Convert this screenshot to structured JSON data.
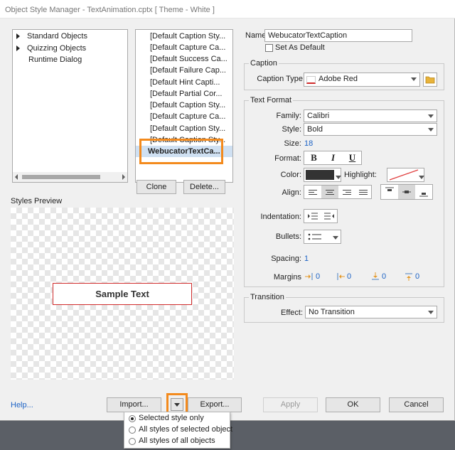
{
  "window": {
    "title": "Object Style Manager - TextAnimation.cptx [ Theme - White ]"
  },
  "tree": {
    "items": [
      {
        "label": "Standard Objects",
        "expandable": true
      },
      {
        "label": "Quizzing Objects",
        "expandable": true
      },
      {
        "label": "Runtime Dialog",
        "expandable": false
      }
    ]
  },
  "style_list": {
    "items": [
      "[Default Caption Sty...",
      "[Default Capture Ca...",
      "[Default Success Ca...",
      "[Default Failure Cap...",
      "[Default Hint Capti...",
      "[Default Partial Cor...",
      "[Default Caption Sty...",
      "[Default Capture Ca...",
      "[Default Caption Sty...",
      "[Default Caption Sty...",
      "WebucatorTextCa..."
    ],
    "selected_index": 10,
    "clone_label": "Clone",
    "delete_label": "Delete..."
  },
  "preview": {
    "title": "Styles Preview",
    "sample_text": "Sample Text"
  },
  "name_field": {
    "label": "Name",
    "value": "WebucatorTextCaption"
  },
  "set_default": {
    "label": "Set As Default",
    "checked": false
  },
  "caption": {
    "group_title": "Caption",
    "type_label": "Caption Type",
    "type_value": "Adobe Red"
  },
  "text_format": {
    "group_title": "Text Format",
    "family_label": "Family:",
    "family_value": "Calibri",
    "style_label": "Style:",
    "style_value": "Bold",
    "size_label": "Size:",
    "size_value": "18",
    "format_label": "Format:",
    "format_bold": "B",
    "format_italic": "I",
    "format_underline": "U",
    "color_label": "Color:",
    "highlight_label": "Highlight:",
    "align_label": "Align:",
    "indentation_label": "Indentation:",
    "bullets_label": "Bullets:",
    "spacing_label": "Spacing:",
    "spacing_value": "1",
    "margins_label": "Margins",
    "margins": [
      "0",
      "0",
      "0",
      "0"
    ],
    "text_color": "#333333",
    "highlight_line_color": "#e04040"
  },
  "transition": {
    "group_title": "Transition",
    "effect_label": "Effect:",
    "effect_value": "No Transition"
  },
  "footer": {
    "help_label": "Help...",
    "import_label": "Import...",
    "export_label": "Export...",
    "apply_label": "Apply",
    "ok_label": "OK",
    "cancel_label": "Cancel"
  },
  "export_menu": {
    "options": [
      {
        "label": "Selected style only",
        "selected": true
      },
      {
        "label": "All styles of selected object",
        "selected": false
      },
      {
        "label": "All styles of all objects",
        "selected": false
      }
    ]
  },
  "colors": {
    "accent_highlight": "#f38a1d",
    "link": "#1d63c5",
    "selection_bg": "#cfe0f2",
    "sample_border": "#d02b2b"
  }
}
